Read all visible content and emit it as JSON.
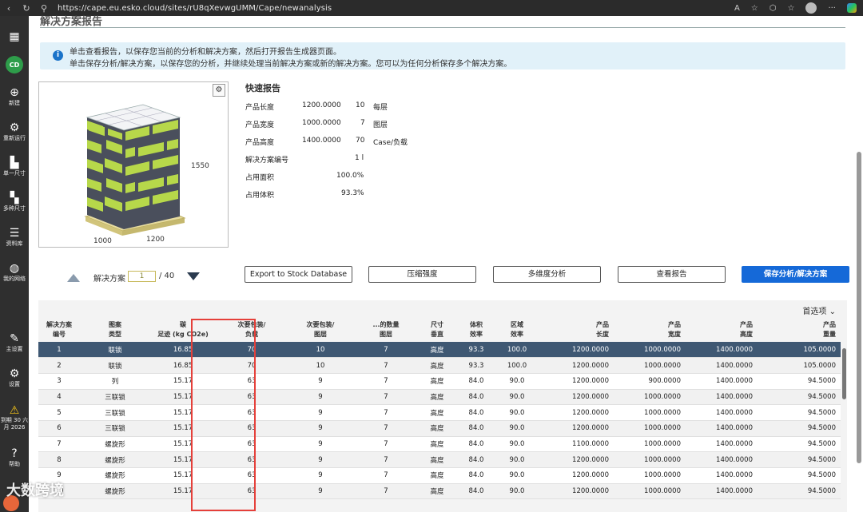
{
  "browser": {
    "url": "https://cape.eu.esko.cloud/sites/rU8qXevwgUMM/Cape/newanalysis"
  },
  "sidebar": {
    "user_initials": "CD",
    "items": [
      {
        "label": "新建",
        "icon": "plus-circle-icon"
      },
      {
        "label": "重新运行",
        "icon": "rerun-icon"
      },
      {
        "label": "单一尺寸",
        "icon": "single-size-icon"
      },
      {
        "label": "多种尺寸",
        "icon": "multi-size-icon"
      },
      {
        "label": "资料库",
        "icon": "database-icon"
      },
      {
        "label": "我的网络",
        "icon": "globe-icon"
      },
      {
        "label": "主设置",
        "icon": "wrench-icon"
      },
      {
        "label": "设置",
        "icon": "gear-icon"
      },
      {
        "label": "到期 30 六月 2026",
        "icon": "warning-icon"
      },
      {
        "label": "帮助",
        "icon": "help-icon"
      }
    ]
  },
  "page": {
    "title": "解决方案报告",
    "info_line1": "单击查看报告，以保存您当前的分析和解决方案，然后打开报告生成器页面。",
    "info_line2": "单击保存分析/解决方案，以保存您的分析，并继续处理当前解决方案或新的解决方案。您可以为任何分析保存多个解决方案。"
  },
  "preview": {
    "dim_height": "1550",
    "dim_left": "1000",
    "dim_right": "1200"
  },
  "quick_report": {
    "title": "快速报告",
    "rows": [
      {
        "label": "产品长度",
        "value": "1200.0000",
        "n": "10",
        "unit": "每层"
      },
      {
        "label": "产品宽度",
        "value": "1000.0000",
        "n": "7",
        "unit": "图层"
      },
      {
        "label": "产品高度",
        "value": "1400.0000",
        "n": "70",
        "unit": "Case/负载"
      },
      {
        "label": "解决方案编号",
        "value": "1 l",
        "n": "",
        "unit": ""
      },
      {
        "label": "占用面积",
        "value": "100.0%",
        "n": "",
        "unit": ""
      },
      {
        "label": "占用体积",
        "value": "93.3%",
        "n": "",
        "unit": ""
      }
    ]
  },
  "solution_nav": {
    "label": "解决方案",
    "current": "1",
    "total": "/ 40"
  },
  "buttons": {
    "export": "Export to Stock Database",
    "compress": "压缩强度",
    "multi": "多维度分析",
    "report": "查看报告",
    "save": "保存分析/解决方案"
  },
  "table": {
    "preferences": "首选项",
    "headers": [
      "解决方案\n编号",
      "图案\n类型",
      "碳\n足迹 (kg CO2e)",
      "次要包装/\n负载",
      "次要包装/\n图层",
      "...的数量\n图层",
      "尺寸\n垂直",
      "体积\n效率",
      "区域\n效率",
      "产品\n长度",
      "产品\n宽度",
      "产品\n高度",
      "产品\n重量"
    ],
    "rows": [
      [
        "1",
        "联锁",
        "16.85",
        "70",
        "10",
        "7",
        "高度",
        "93.3",
        "100.0",
        "1200.0000",
        "1000.0000",
        "1400.0000",
        "105.0000"
      ],
      [
        "2",
        "联锁",
        "16.85",
        "70",
        "10",
        "7",
        "高度",
        "93.3",
        "100.0",
        "1200.0000",
        "1000.0000",
        "1400.0000",
        "105.0000"
      ],
      [
        "3",
        "列",
        "15.17",
        "63",
        "9",
        "7",
        "高度",
        "84.0",
        "90.0",
        "1200.0000",
        "900.0000",
        "1400.0000",
        "94.5000"
      ],
      [
        "4",
        "三联锁",
        "15.17",
        "63",
        "9",
        "7",
        "高度",
        "84.0",
        "90.0",
        "1200.0000",
        "1000.0000",
        "1400.0000",
        "94.5000"
      ],
      [
        "5",
        "三联锁",
        "15.17",
        "63",
        "9",
        "7",
        "高度",
        "84.0",
        "90.0",
        "1200.0000",
        "1000.0000",
        "1400.0000",
        "94.5000"
      ],
      [
        "6",
        "三联锁",
        "15.17",
        "63",
        "9",
        "7",
        "高度",
        "84.0",
        "90.0",
        "1200.0000",
        "1000.0000",
        "1400.0000",
        "94.5000"
      ],
      [
        "7",
        "螺旋形",
        "15.17",
        "63",
        "9",
        "7",
        "高度",
        "84.0",
        "90.0",
        "1100.0000",
        "1000.0000",
        "1400.0000",
        "94.5000"
      ],
      [
        "8",
        "螺旋形",
        "15.17",
        "63",
        "9",
        "7",
        "高度",
        "84.0",
        "90.0",
        "1200.0000",
        "1000.0000",
        "1400.0000",
        "94.5000"
      ],
      [
        "9",
        "螺旋形",
        "15.17",
        "63",
        "9",
        "7",
        "高度",
        "84.0",
        "90.0",
        "1200.0000",
        "1000.0000",
        "1400.0000",
        "94.5000"
      ],
      [
        "10",
        "螺旋形",
        "15.17",
        "63",
        "9",
        "7",
        "高度",
        "84.0",
        "90.0",
        "1200.0000",
        "1000.0000",
        "1400.0000",
        "94.5000"
      ]
    ]
  },
  "watermark": "大数跨境",
  "colors": {
    "primary": "#1569d8",
    "selected_row": "#3f5873",
    "highlight_box": "#e5403a",
    "pallet_green": "#b7d84a",
    "pallet_dark": "#4a4f5c"
  }
}
